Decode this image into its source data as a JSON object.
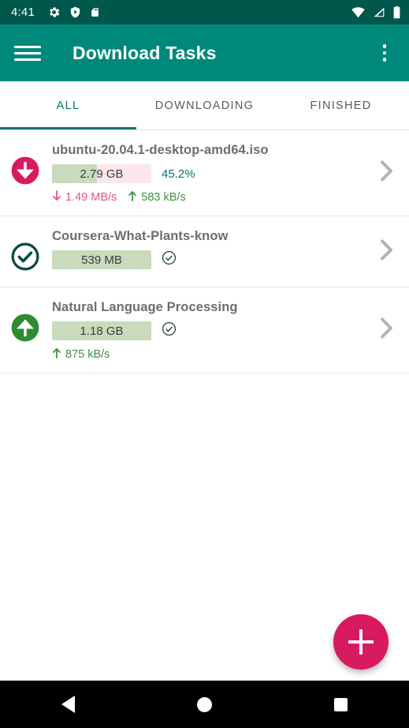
{
  "statusbar": {
    "time": "4:41",
    "left_icons": [
      "gear-icon",
      "shield-play-icon",
      "sdcard-icon"
    ],
    "right_icons": [
      "wifi-icon",
      "cell-signal-icon",
      "battery-icon"
    ],
    "bg_color": "#00574b"
  },
  "appbar": {
    "title": "Download Tasks",
    "menu_icon": "hamburger-icon",
    "overflow_icon": "overflow-menu-icon",
    "bg_color": "#00897b"
  },
  "tabs": {
    "active_index": 0,
    "accent_color": "#00796b",
    "items": [
      {
        "label": "ALL"
      },
      {
        "label": "DOWNLOADING"
      },
      {
        "label": "FINISHED"
      }
    ]
  },
  "tasks": [
    {
      "title": "ubuntu-20.04.1-desktop-amd64.iso",
      "status_icon": "download-circle-icon",
      "status_icon_color": "#d81b60",
      "size": "2.79 GB",
      "progress_percent": 45.2,
      "percent_label": "45.2%",
      "complete": false,
      "download_speed": "1.49 MB/s",
      "upload_speed": "583 kB/s",
      "chevron_icon": "chevron-right-icon"
    },
    {
      "title": "Coursera-What-Plants-know",
      "status_icon": "check-circle-outline-icon",
      "status_icon_color": "#0d4b43",
      "size": "539 MB",
      "progress_percent": 100,
      "percent_label": "",
      "complete": true,
      "download_speed": "",
      "upload_speed": "",
      "chevron_icon": "chevron-right-icon"
    },
    {
      "title": "Natural Language Processing",
      "status_icon": "upload-circle-icon",
      "status_icon_color": "#2e8b32",
      "size": "1.18 GB",
      "progress_percent": 100,
      "percent_label": "",
      "complete": true,
      "download_speed": "",
      "upload_speed": "875 kB/s",
      "chevron_icon": "chevron-right-icon"
    }
  ],
  "fab": {
    "icon": "plus-icon",
    "color": "#d81b60"
  },
  "navbar": {
    "back": "back-icon",
    "home": "home-icon",
    "recents": "recents-icon"
  }
}
